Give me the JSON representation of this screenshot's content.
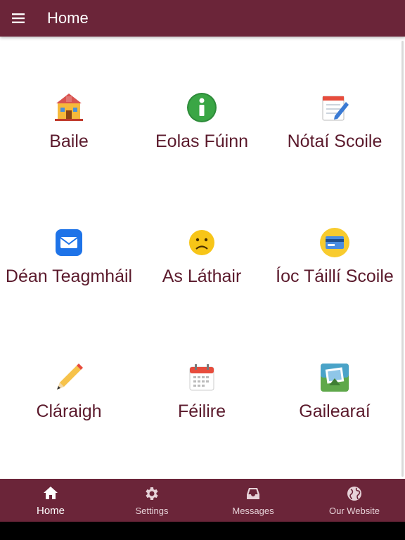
{
  "appbar": {
    "title": "Home"
  },
  "tiles": [
    {
      "label": "Baile",
      "icon": "school-icon"
    },
    {
      "label": "Eolas Fúinn",
      "icon": "info-icon"
    },
    {
      "label": "Nótaí Scoile",
      "icon": "notepad-icon"
    },
    {
      "label": "Déan Teagmháil",
      "icon": "mail-icon"
    },
    {
      "label": "As Láthair",
      "icon": "sad-face-icon"
    },
    {
      "label": "Íoc Táillí Scoile",
      "icon": "credit-card-icon"
    },
    {
      "label": "Cláraigh",
      "icon": "pencil-icon"
    },
    {
      "label": "Féilire",
      "icon": "calendar-icon"
    },
    {
      "label": "Gailearaí",
      "icon": "gallery-icon"
    }
  ],
  "bottom_nav": [
    {
      "label": "Home",
      "icon": "home-icon",
      "active": true
    },
    {
      "label": "Settings",
      "icon": "gear-icon",
      "active": false
    },
    {
      "label": "Messages",
      "icon": "inbox-icon",
      "active": false
    },
    {
      "label": "Our Website",
      "icon": "globe-icon",
      "active": false
    }
  ],
  "colors": {
    "primary": "#6b2539",
    "label": "#5b1a2c"
  }
}
